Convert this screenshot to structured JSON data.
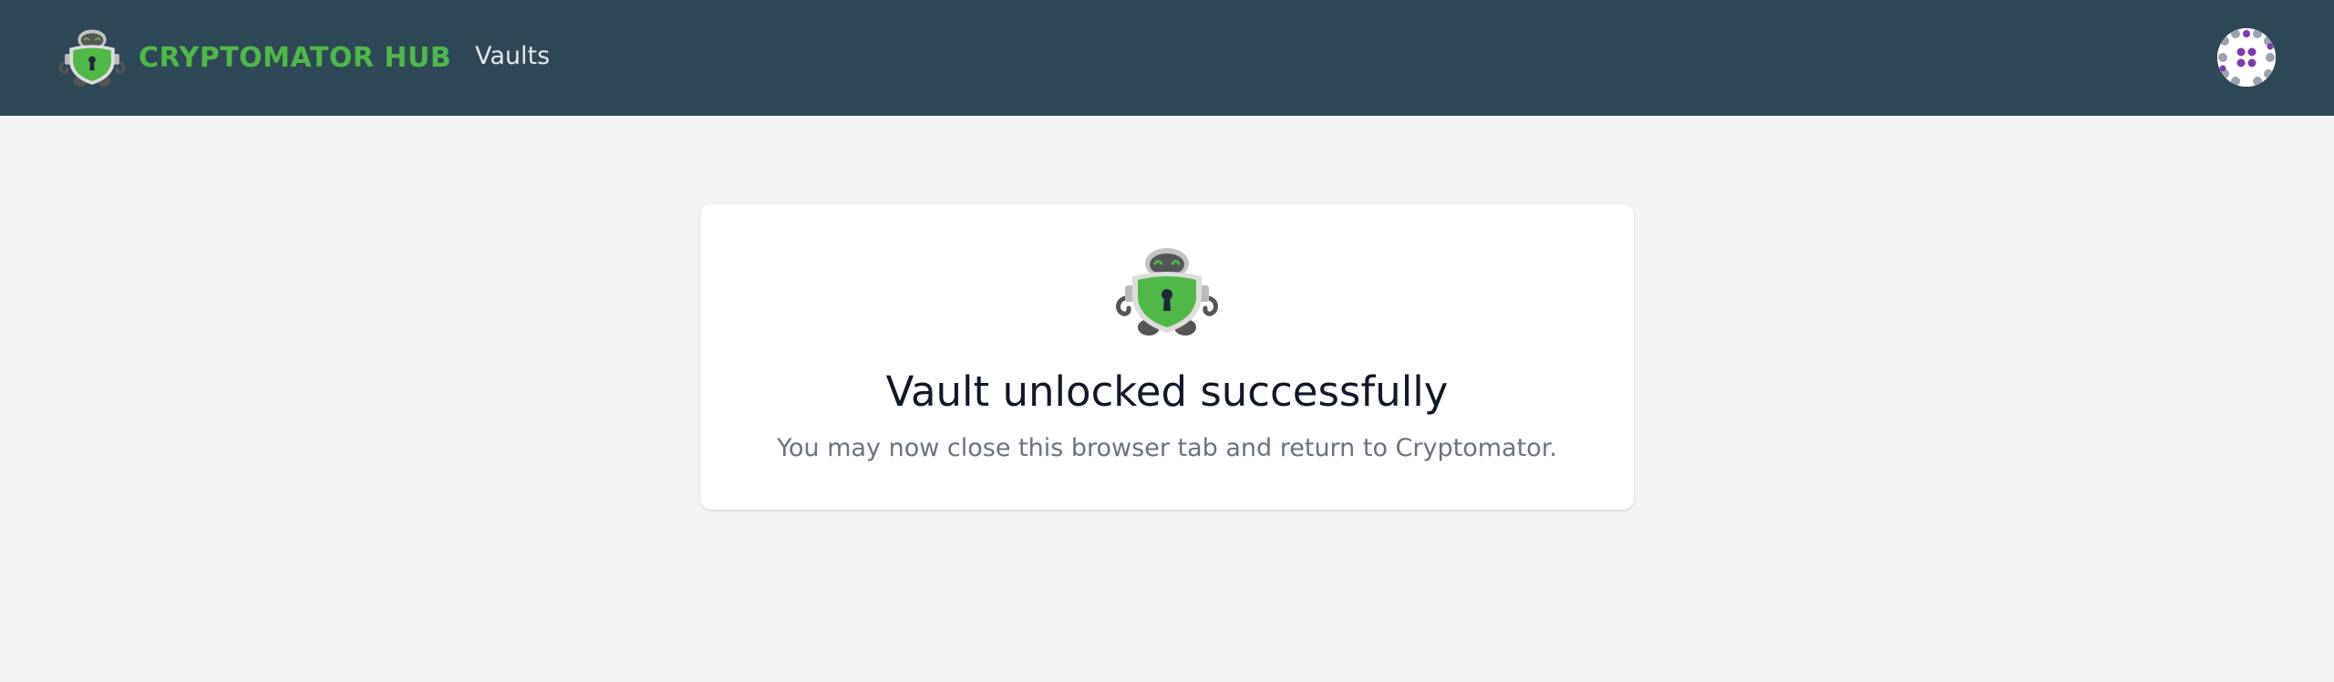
{
  "header": {
    "brand_name": "CRYPTOMATOR HUB",
    "logo_icon": "cryptomator-robot-icon",
    "nav": [
      {
        "label": "Vaults"
      }
    ],
    "avatar_icon": "user-avatar-identicon"
  },
  "main": {
    "card": {
      "icon": "cryptomator-robot-icon",
      "title": "Vault unlocked successfully",
      "subtitle": "You may now close this browser tab and return to Cryptomator."
    }
  },
  "colors": {
    "header_background": "#2f4858",
    "brand_green": "#50b848",
    "page_background": "#f3f4f6",
    "card_background": "#ffffff",
    "title_text": "#111827",
    "subtitle_text": "#6b7280",
    "avatar_accent": "#7e3ab0"
  }
}
